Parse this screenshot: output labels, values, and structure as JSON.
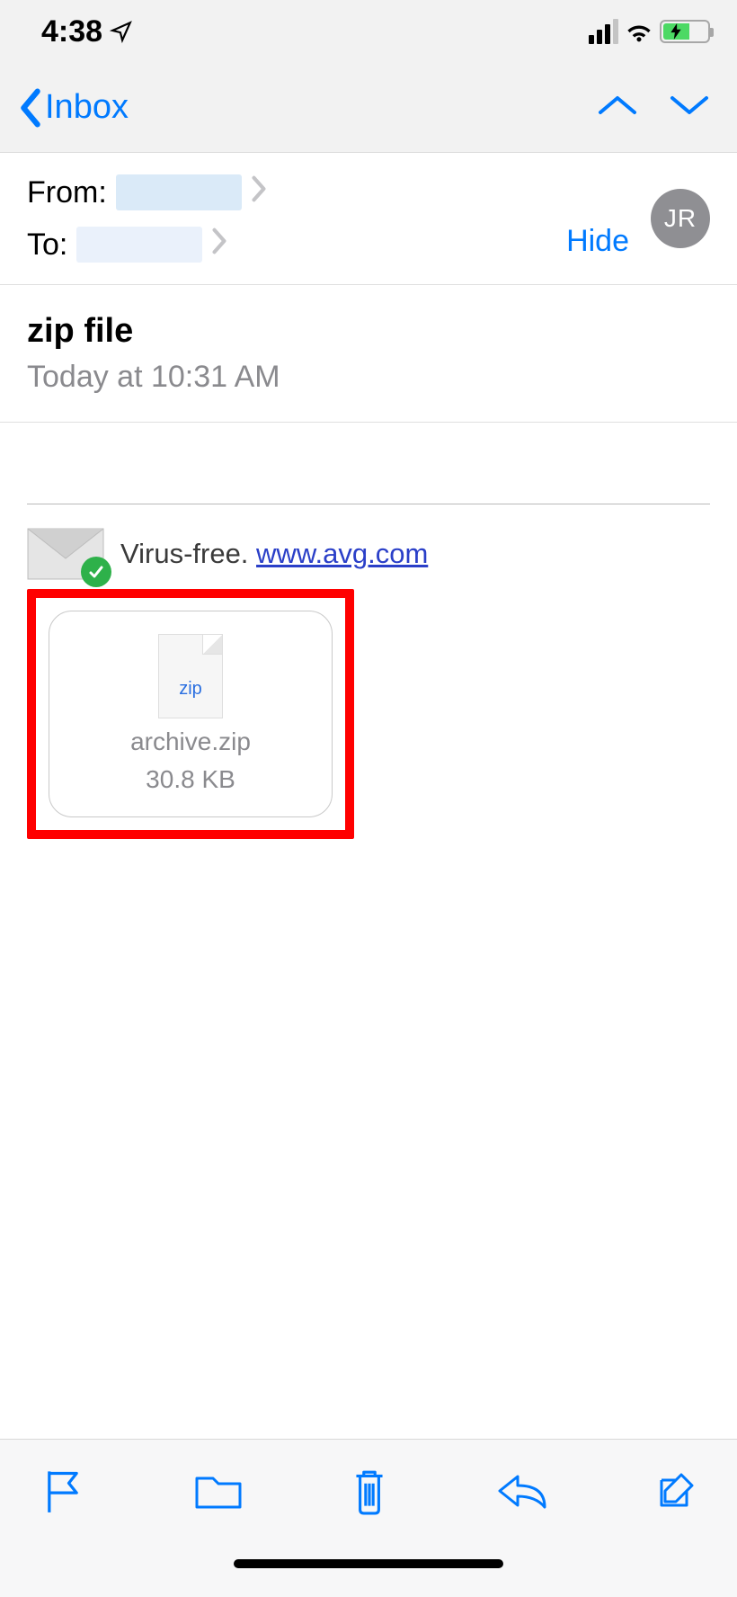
{
  "status": {
    "time": "4:38"
  },
  "nav": {
    "back_label": "Inbox"
  },
  "headers": {
    "from_label": "From:",
    "to_label": "To:",
    "hide_label": "Hide",
    "avatar_initials": "JR"
  },
  "message": {
    "subject": "zip file",
    "datetime": "Today at 10:31 AM"
  },
  "virus_banner": {
    "text": "Virus-free.",
    "link": "www.avg.com"
  },
  "attachment": {
    "ext_label": "zip",
    "filename": "archive.zip",
    "size": "30.8 KB"
  }
}
